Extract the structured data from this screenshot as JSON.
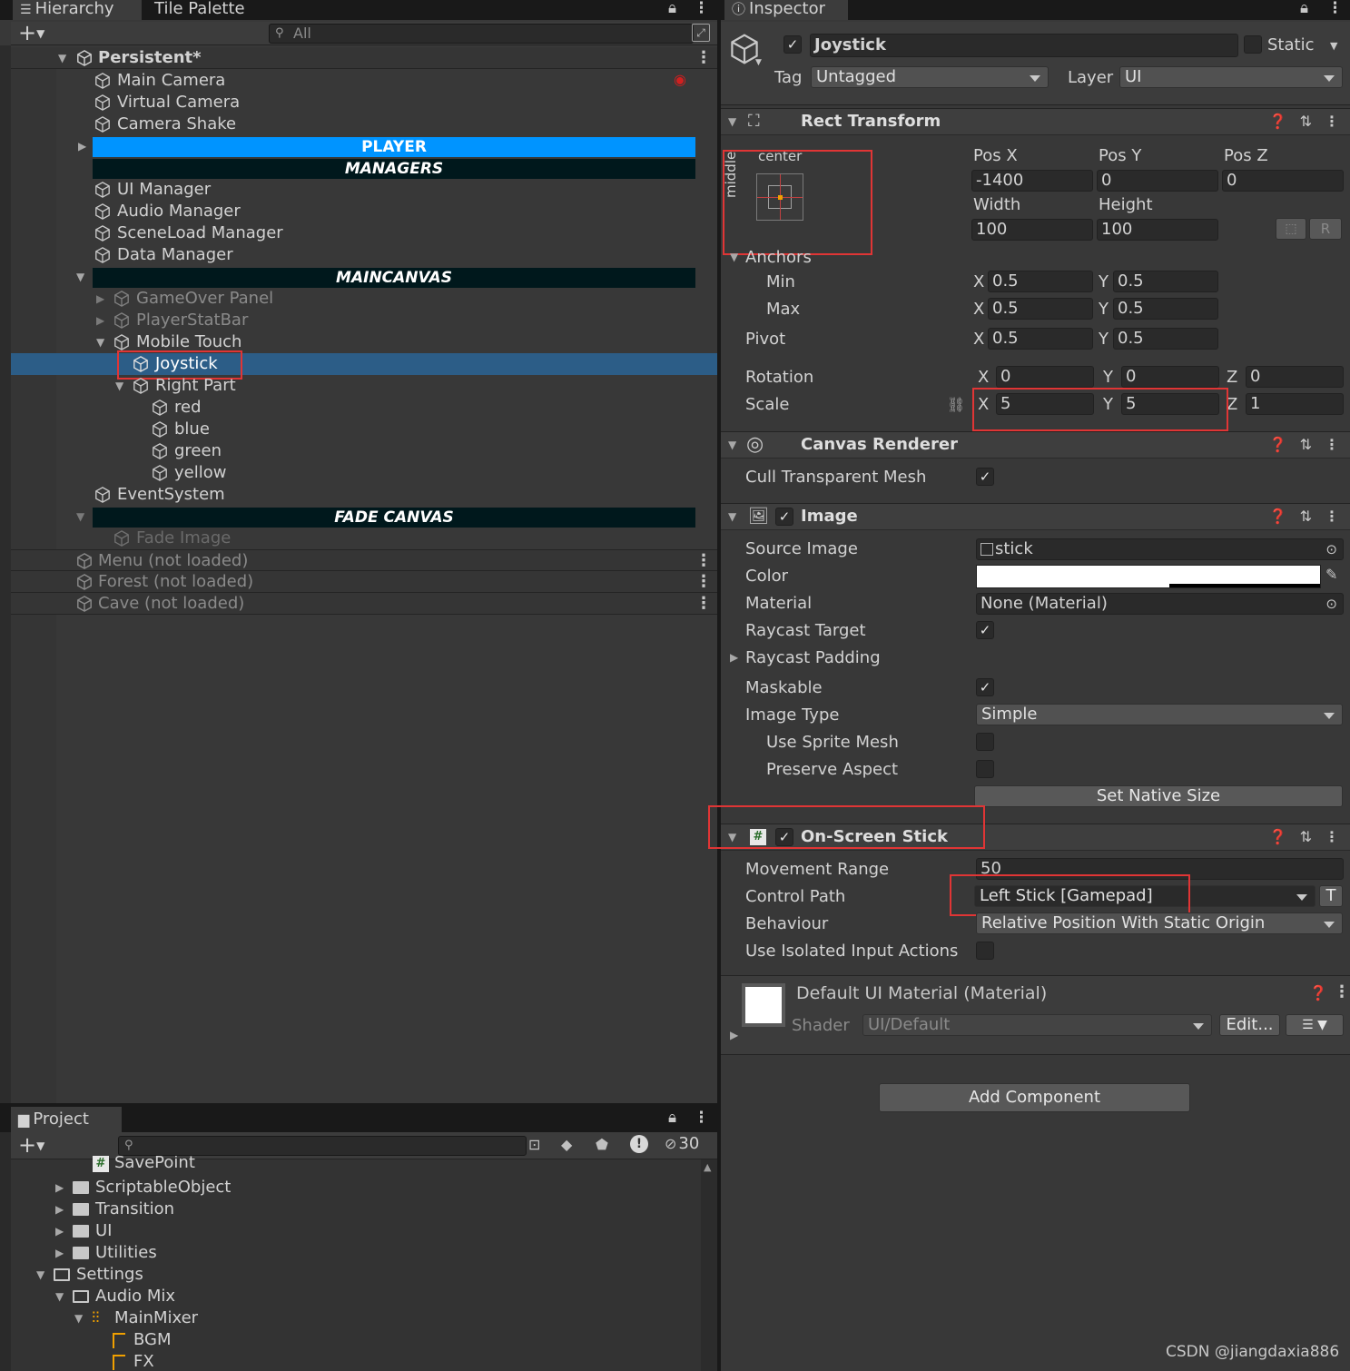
{
  "hierarchy": {
    "tab_label": "Hierarchy",
    "tab2_label": "Tile Palette",
    "search_placeholder": "All",
    "scene_name": "Persistent*",
    "rows": {
      "main_camera": "Main Camera",
      "virtual_camera": "Virtual Camera",
      "camera_shake": "Camera Shake",
      "player": "PLAYER",
      "managers": "MANAGERS",
      "ui_manager": "UI Manager",
      "audio_manager": "Audio Manager",
      "sceneload_manager": "SceneLoad Manager",
      "data_manager": "Data Manager",
      "maincanvas": "MAINCANVAS",
      "gameover_panel": "GameOver Panel",
      "playerstatbar": "PlayerStatBar",
      "mobile_touch": "Mobile Touch",
      "joystick": "Joystick",
      "right_part": "Right Part",
      "red": "red",
      "blue": "blue",
      "green": "green",
      "yellow": "yellow",
      "eventsystem": "EventSystem",
      "fade_canvas": "FADE CANVAS",
      "fade_image": "Fade Image"
    },
    "scenes_not_loaded": [
      "Menu (not loaded)",
      "Forest (not loaded)",
      "Cave (not loaded)"
    ]
  },
  "project": {
    "tab_label": "Project",
    "hidden_count": "30",
    "items": [
      "SavePoint",
      "ScriptableObject",
      "Transition",
      "UI",
      "Utilities",
      "Settings",
      "Audio Mix",
      "MainMixer",
      "BGM",
      "FX"
    ]
  },
  "inspector": {
    "tab_label": "Inspector",
    "object_name": "Joystick",
    "static_label": "Static",
    "tag_label": "Tag",
    "tag_value": "Untagged",
    "layer_label": "Layer",
    "layer_value": "UI",
    "rect": {
      "title": "Rect Transform",
      "anchor_h": "center",
      "anchor_v": "middle",
      "posx_label": "Pos X",
      "posy_label": "Pos Y",
      "posz_label": "Pos Z",
      "posx": "-1400",
      "posy": "0",
      "posz": "0",
      "width_label": "Width",
      "height_label": "Height",
      "width": "100",
      "height": "100",
      "anchors_label": "Anchors",
      "min_label": "Min",
      "max_label": "Max",
      "pivot_label": "Pivot",
      "min_x": "0.5",
      "min_y": "0.5",
      "max_x": "0.5",
      "max_y": "0.5",
      "pivot_x": "0.5",
      "pivot_y": "0.5",
      "rotation_label": "Rotation",
      "rot_x": "0",
      "rot_y": "0",
      "rot_z": "0",
      "scale_label": "Scale",
      "scale_x": "5",
      "scale_y": "5",
      "scale_z": "1",
      "r_button": "R"
    },
    "canvas_renderer": {
      "title": "Canvas Renderer",
      "cull_label": "Cull Transparent Mesh"
    },
    "image": {
      "title": "Image",
      "source_label": "Source Image",
      "source_value": "stick",
      "color_label": "Color",
      "material_label": "Material",
      "material_value": "None (Material)",
      "raycast_target": "Raycast Target",
      "raycast_padding": "Raycast Padding",
      "maskable": "Maskable",
      "image_type_label": "Image Type",
      "image_type_value": "Simple",
      "use_sprite_mesh": "Use Sprite Mesh",
      "preserve_aspect": "Preserve Aspect",
      "native_size_btn": "Set Native Size"
    },
    "onscreen": {
      "title": "On-Screen Stick",
      "movement_label": "Movement Range",
      "movement_value": "50",
      "control_label": "Control Path",
      "control_value": "Left Stick [Gamepad]",
      "t_button": "T",
      "behaviour_label": "Behaviour",
      "behaviour_value": "Relative Position With Static Origin",
      "isolated_label": "Use Isolated Input Actions"
    },
    "material": {
      "title": "Default UI Material (Material)",
      "shader_label": "Shader",
      "shader_value": "UI/Default",
      "edit_btn": "Edit..."
    },
    "add_component": "Add Component"
  },
  "watermark": "CSDN @jiangdaxia886",
  "colors": {
    "selection": "#2c5d87",
    "player_banner": "#0094ff",
    "dark_banner": "#00181c",
    "highlight": "#e03535"
  }
}
